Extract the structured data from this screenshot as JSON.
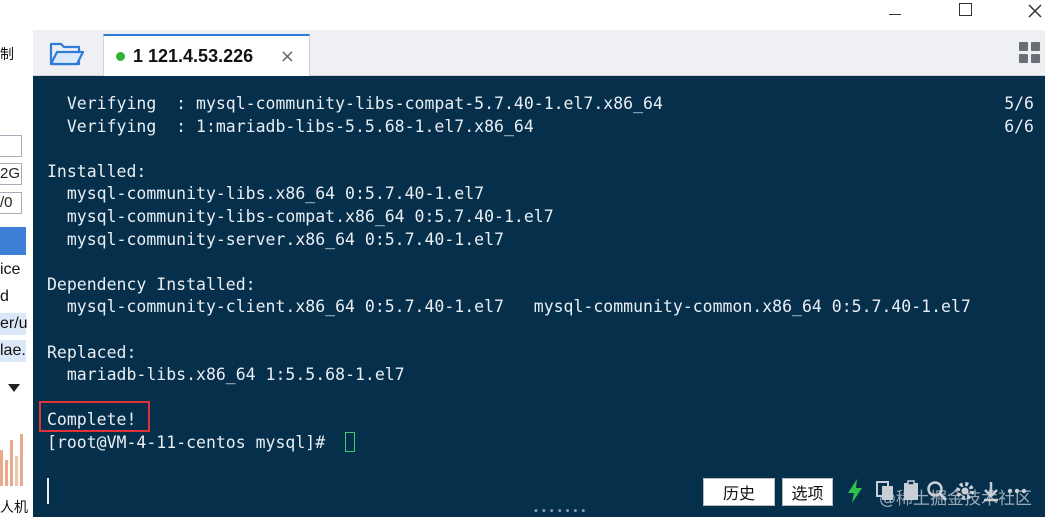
{
  "window": {
    "minimize": "—",
    "maximize": "□",
    "close": "✕"
  },
  "left_window": {
    "texts": [
      "制",
      "ice",
      "d",
      "er/u",
      "lae.",
      "人机"
    ],
    "boxes": [
      "2G",
      "/0"
    ]
  },
  "tab": {
    "label": "1 121.4.53.226",
    "close": "×",
    "status_color": "#2fb52f"
  },
  "terminal": {
    "lines": [
      {
        "text": "  Verifying  : mysql-community-libs-compat-5.7.40-1.el7.x86_64",
        "count": "5/6"
      },
      {
        "text": "  Verifying  : 1:mariadb-libs-5.5.68-1.el7.x86_64",
        "count": "6/6"
      },
      {
        "text": "",
        "count": ""
      },
      {
        "text": "Installed:",
        "count": ""
      },
      {
        "text": "  mysql-community-libs.x86_64 0:5.7.40-1.el7",
        "count": ""
      },
      {
        "text": "  mysql-community-libs-compat.x86_64 0:5.7.40-1.el7",
        "count": ""
      },
      {
        "text": "  mysql-community-server.x86_64 0:5.7.40-1.el7",
        "count": ""
      },
      {
        "text": "",
        "count": ""
      },
      {
        "text": "Dependency Installed:",
        "count": ""
      },
      {
        "text": "  mysql-community-client.x86_64 0:5.7.40-1.el7   mysql-community-common.x86_64 0:5.7.40-1.el7",
        "count": ""
      },
      {
        "text": "",
        "count": ""
      },
      {
        "text": "Replaced:",
        "count": ""
      },
      {
        "text": "  mariadb-libs.x86_64 1:5.5.68-1.el7",
        "count": ""
      },
      {
        "text": "",
        "count": ""
      },
      {
        "text": "Complete!",
        "count": ""
      }
    ],
    "prompt": "[root@VM-4-11-centos mysql]# "
  },
  "toolbar": {
    "history_label": "历史",
    "options_label": "选项",
    "watermark": "@稀土掘金技术社区"
  },
  "colors": {
    "terminal_bg": "#062f4c",
    "terminal_fg": "#e9eef2",
    "highlight_border": "#e0343a",
    "cursor": "#38d06a",
    "lightning": "#2fc24a"
  }
}
